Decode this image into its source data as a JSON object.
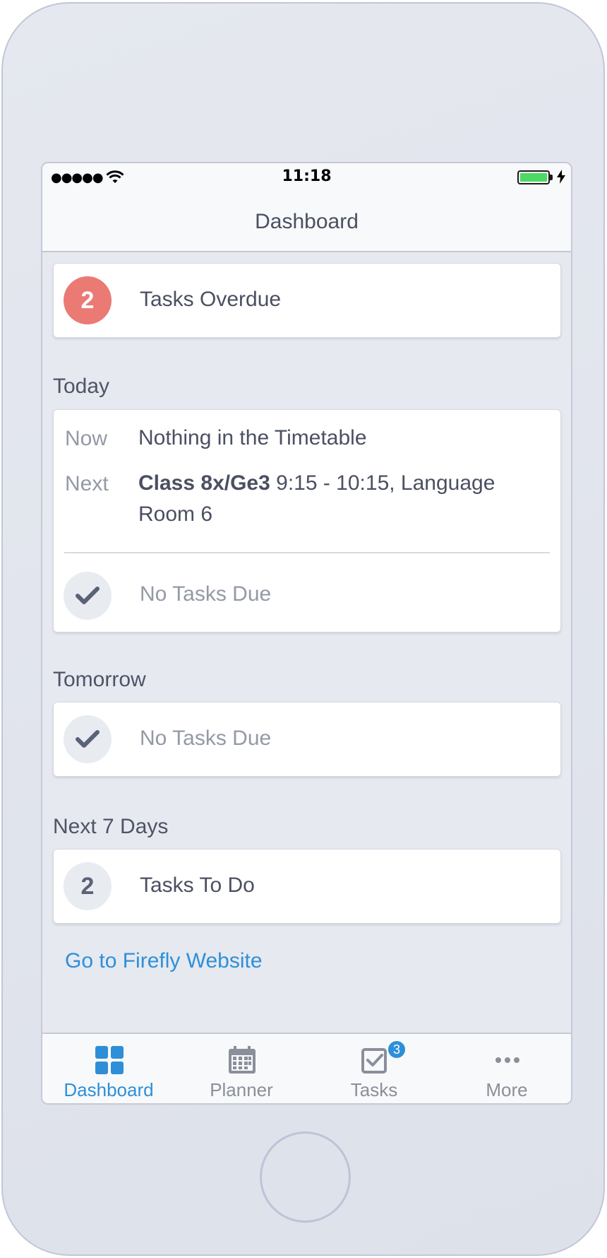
{
  "status_bar": {
    "time": "11:18",
    "signal": "●●●●●"
  },
  "nav": {
    "title": "Dashboard"
  },
  "overdue": {
    "count": "2",
    "label": "Tasks Overdue"
  },
  "today": {
    "title": "Today",
    "now_key": "Now",
    "now_value": "Nothing in the Timetable",
    "next_key": "Next",
    "next_class": "Class 8x/Ge3",
    "next_detail": " 9:15 - 10:15, Language Room 6",
    "tasks_label": "No Tasks Due"
  },
  "tomorrow": {
    "title": "Tomorrow",
    "tasks_label": "No Tasks Due"
  },
  "next7": {
    "title": "Next 7 Days",
    "count": "2",
    "label": "Tasks To Do"
  },
  "link": {
    "label": "Go to Firefly Website"
  },
  "tabs": [
    {
      "label": "Dashboard",
      "icon": "dashboard-grid-icon",
      "active": true
    },
    {
      "label": "Planner",
      "icon": "calendar-icon",
      "active": false
    },
    {
      "label": "Tasks",
      "icon": "checkbox-icon",
      "active": false,
      "badge": "3"
    },
    {
      "label": "More",
      "icon": "ellipsis-icon",
      "active": false
    }
  ],
  "colors": {
    "accent": "#2e8fd8",
    "overdue": "#ea7a73",
    "text": "#4a5061",
    "muted": "#9499a6",
    "battery": "#4cd964"
  }
}
